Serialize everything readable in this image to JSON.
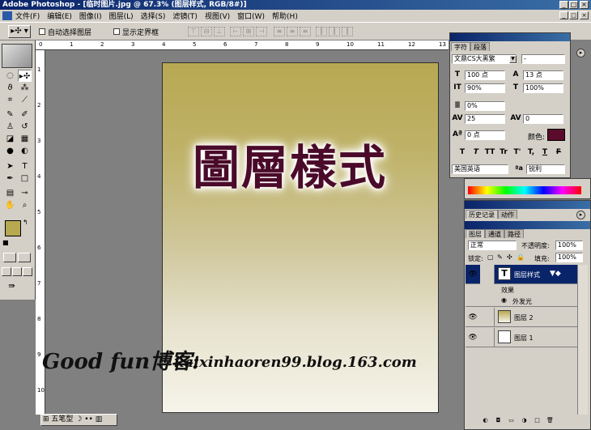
{
  "window": {
    "title": "Adobe Photoshop - [临时图片.jpg @ 67.3% (图层样式, RGB/8#)]",
    "minimize_glyph": "_",
    "maximize_glyph": "□",
    "close_glyph": "×"
  },
  "menubar": {
    "items": [
      "文件(F)",
      "编辑(E)",
      "图像(I)",
      "图层(L)",
      "选择(S)",
      "滤镜(T)",
      "视图(V)",
      "窗口(W)",
      "帮助(H)"
    ]
  },
  "options": {
    "auto_select_layer": "自动选择图层",
    "show_bounding_box": "显示定界框"
  },
  "rulers": {
    "h_ticks": [
      "0",
      "1",
      "2",
      "3",
      "4",
      "5",
      "6",
      "7",
      "8",
      "9",
      "10",
      "11",
      "12",
      "13"
    ],
    "v_ticks": [
      "1",
      "2",
      "3",
      "4",
      "5",
      "6",
      "7",
      "8",
      "9",
      "10"
    ]
  },
  "document": {
    "heading": "圖層樣式",
    "gradient_top": "#b7a852",
    "gradient_bottom": "#f6f4ea",
    "text_color": "#4a0a2a"
  },
  "watermark": {
    "label": "Good fun博客:",
    "url": "kaixinhaoren99.blog.163.com"
  },
  "statusbar": {
    "ime_label": "五笔型"
  },
  "character_panel": {
    "tabs": [
      "字符",
      "段落"
    ],
    "font_family": "文鼎CS大黑繁",
    "font_style": "-",
    "font_size": "100 点",
    "leading": "13 点",
    "vertical_scale": "90%",
    "horizontal_scale": "100%",
    "baseline_shift_pct": "0%",
    "tracking": "25",
    "kerning": "0",
    "baseline_shift": "0 点",
    "color_label": "颜色:",
    "text_color": "#5a0a2a",
    "style_buttons": [
      "T",
      "T",
      "TT",
      "Tr",
      "T'",
      "T,",
      "T",
      "F"
    ],
    "language": "美国英语",
    "antialias": "锐利"
  },
  "layers_panel": {
    "top_tabs": [
      "历史记录",
      "动作"
    ],
    "tabs": [
      "图层",
      "通道",
      "路径"
    ],
    "blend_mode": "正常",
    "opacity_label": "不透明度:",
    "opacity": "100%",
    "lock_label": "锁定:",
    "fill_label": "填充:",
    "fill": "100%",
    "layers": [
      {
        "name": "图层样式",
        "thumb": "T",
        "selected": true
      },
      {
        "name": "效果",
        "selected": false
      },
      {
        "name": "外发光",
        "selected": false
      },
      {
        "name": "图层 2",
        "selected": false
      },
      {
        "name": "图层 1",
        "selected": false
      }
    ]
  },
  "toolbox": {
    "foreground": "#b7a852",
    "background": "#ffffff"
  }
}
